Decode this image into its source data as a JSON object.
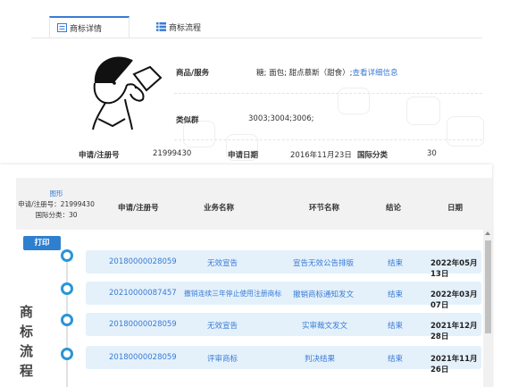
{
  "tabs": [
    {
      "label": "商标详情",
      "icon": "detail-list-icon",
      "active": true
    },
    {
      "label": "商标流程",
      "icon": "flow-list-icon",
      "active": false
    }
  ],
  "detail": {
    "goods_label": "商品/服务",
    "goods_value": "糖; 面包; 甜点慕斯（甜食）;",
    "goods_link": "查看详细信息",
    "similar_label": "类似群",
    "similar_value": "3003;3004;3006;",
    "reg_no_label": "申请/注册号",
    "reg_no_value": "21999430",
    "date_label": "申请日期",
    "date_value": "2016年11月23日",
    "class_label": "国际分类",
    "class_value": "30"
  },
  "flow": {
    "image_label": "图形",
    "reg_info": "申请/注册号：21999430",
    "class_info": "国际分类：30",
    "headers": [
      "申请/注册号",
      "业务名称",
      "环节名称",
      "结论",
      "日期"
    ],
    "print_label": "打印",
    "vertical_title": [
      "商",
      "标",
      "流",
      "程"
    ],
    "rows": [
      {
        "no": "20180000028059",
        "business": "无效宣告",
        "step": "宣告无效公告排版",
        "result": "结束",
        "date": "2022年05月13日"
      },
      {
        "no": "20210000087457",
        "business": "撤销连续三年停止使用注册商标",
        "step": "撤销商标通知发文",
        "result": "结束",
        "date": "2022年03月07日"
      },
      {
        "no": "20180000028059",
        "business": "无效宣告",
        "step": "实审裁文发文",
        "result": "结束",
        "date": "2021年12月28日"
      },
      {
        "no": "20180000028059",
        "business": "评审商标",
        "step": "判决结果",
        "result": "结束",
        "date": "2021年11月26日"
      }
    ]
  },
  "colors": {
    "accent": "#3a7bd5",
    "row_bg": "#e4f1fb",
    "print_btn": "#2f7fd0",
    "circle": "#2a95d8"
  }
}
